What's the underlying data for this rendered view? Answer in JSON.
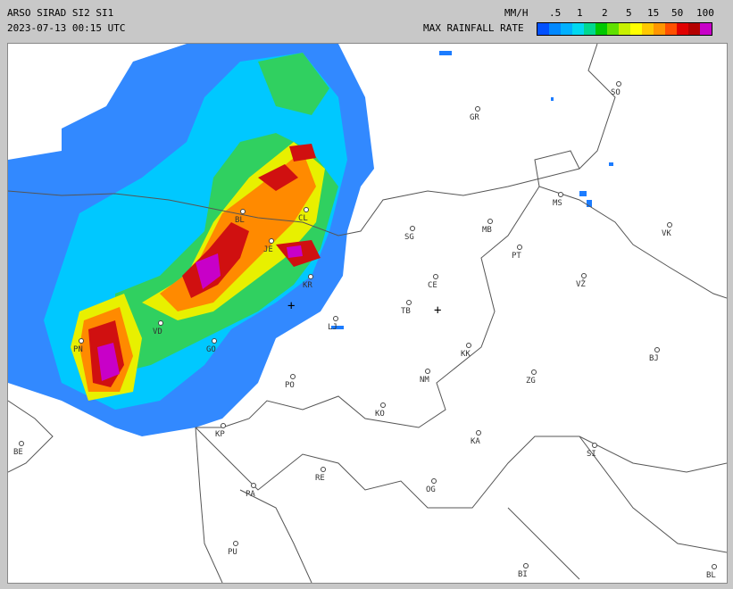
{
  "header": {
    "title": "ARSO SIRAD SI2 SI1",
    "timestamp": "2023-07-13 00:15 UTC",
    "units": "MM/H",
    "legend_title": "MAX RAINFALL RATE",
    "scale_labels": [
      ".5",
      "1",
      "2",
      "5",
      "15",
      "50",
      "100"
    ]
  },
  "legend_colors": [
    "#0050ff",
    "#0088ff",
    "#00b0ff",
    "#00d8f0",
    "#00d890",
    "#00c800",
    "#60e000",
    "#c8f000",
    "#ffff00",
    "#ffc800",
    "#ff9600",
    "#ff5000",
    "#e00000",
    "#b40000",
    "#c800c8"
  ],
  "cities": [
    {
      "code": "SO"
    },
    {
      "code": "GR"
    },
    {
      "code": "CL"
    },
    {
      "code": "BL"
    },
    {
      "code": "MS"
    },
    {
      "code": "MB"
    },
    {
      "code": "SG"
    },
    {
      "code": "VK"
    },
    {
      "code": "JE"
    },
    {
      "code": "PT"
    },
    {
      "code": "CE"
    },
    {
      "code": "KR"
    },
    {
      "code": "VŽ"
    },
    {
      "code": "TB"
    },
    {
      "code": "LJ"
    },
    {
      "code": "VD"
    },
    {
      "code": "PN"
    },
    {
      "code": "GO"
    },
    {
      "code": "KK"
    },
    {
      "code": "BJ"
    },
    {
      "code": "NM"
    },
    {
      "code": "ZG"
    },
    {
      "code": "PO"
    },
    {
      "code": "KO"
    },
    {
      "code": "KP"
    },
    {
      "code": "KA"
    },
    {
      "code": "SI"
    },
    {
      "code": "BE"
    },
    {
      "code": "RE"
    },
    {
      "code": "OG"
    },
    {
      "code": "PA"
    },
    {
      "code": "PU"
    },
    {
      "code": "BI"
    },
    {
      "code": "BL"
    }
  ]
}
